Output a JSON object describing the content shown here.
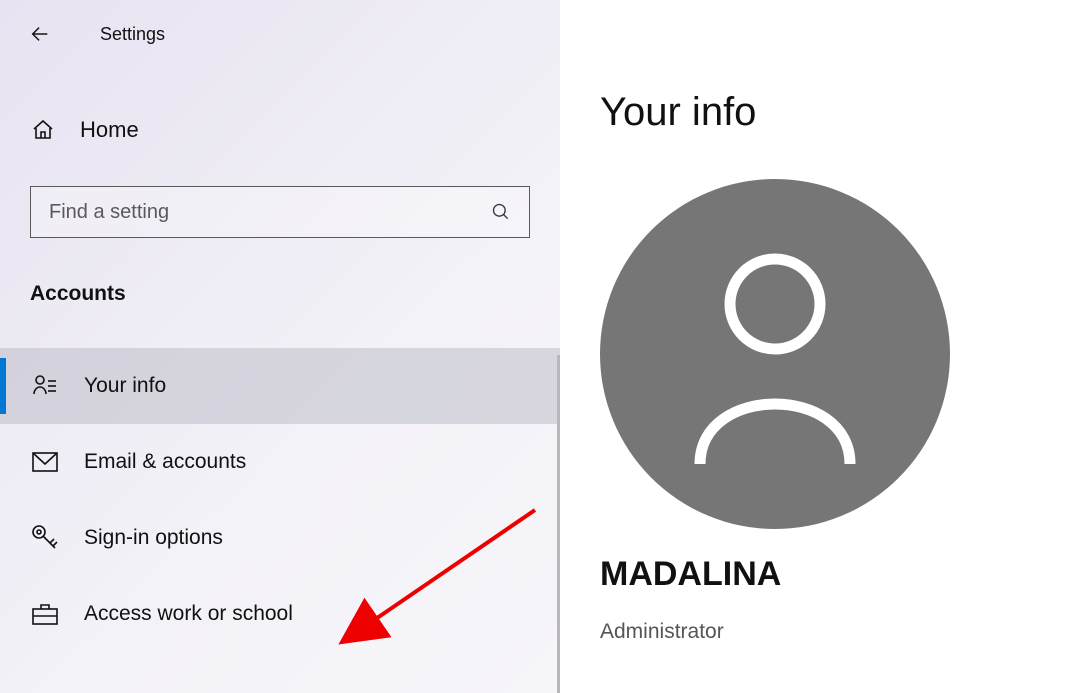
{
  "window": {
    "title": "Settings"
  },
  "sidebar": {
    "home_label": "Home",
    "search_placeholder": "Find a setting",
    "section": "Accounts",
    "items": [
      {
        "label": "Your info"
      },
      {
        "label": "Email & accounts"
      },
      {
        "label": "Sign-in options"
      },
      {
        "label": "Access work or school"
      }
    ]
  },
  "main": {
    "heading": "Your info",
    "user_name": "MADALINA",
    "role": "Administrator"
  }
}
